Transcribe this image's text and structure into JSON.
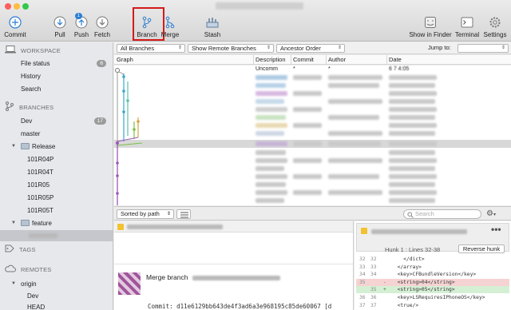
{
  "toolbar": {
    "items": [
      {
        "label": "Commit"
      },
      {
        "label": "Pull"
      },
      {
        "label": "Push",
        "badge": "1"
      },
      {
        "label": "Fetch"
      },
      {
        "label": "Branch"
      },
      {
        "label": "Merge"
      },
      {
        "label": "Stash"
      },
      {
        "label": "Show in Finder"
      },
      {
        "label": "Terminal"
      },
      {
        "label": "Settings"
      }
    ]
  },
  "sidebar": {
    "workspace": "WORKSPACE",
    "file_status": "File status",
    "file_status_count": "6",
    "history": "History",
    "search": "Search",
    "branches": "BRANCHES",
    "dev": "Dev",
    "dev_count": "17",
    "master": "master",
    "release": "Release",
    "release_branches": [
      "101R04P",
      "101R04T",
      "101R05",
      "101R05P",
      "101R05T"
    ],
    "feature": "feature",
    "tags": "TAGS",
    "remotes": "REMOTES",
    "origin": "origin",
    "remote_dev": "Dev",
    "remote_head": "HEAD"
  },
  "filter": {
    "branches": "All Branches",
    "remote": "Show Remote Branches",
    "order": "Ancestor Order",
    "jump_label": "Jump to:"
  },
  "table": {
    "columns": [
      "Graph",
      "Description",
      "Commit",
      "Author",
      "Date"
    ],
    "first_row": {
      "description": "Uncomm",
      "commit": "*",
      "author": "*",
      "date": "6 7 4:05"
    }
  },
  "lower": {
    "sort": "Sorted by path",
    "search_placeholder": "Search"
  },
  "details": {
    "title": "Merge branch",
    "commit_label": "Commit:",
    "commit_hash": "d11e6129bb643de4f3ad6a3e968195c85de60067 [d"
  },
  "diff": {
    "hunk_label": "Hunk 1 : Lines 32-38",
    "reverse_label": "Reverse hunk",
    "lines": [
      {
        "n1": "32",
        "n2": "32",
        "sign": "",
        "code": "    </dict>",
        "kind": "ctx"
      },
      {
        "n1": "33",
        "n2": "33",
        "sign": "",
        "code": "  </array>",
        "kind": "ctx"
      },
      {
        "n1": "34",
        "n2": "34",
        "sign": "",
        "code": "  <key>CFBundleVersion</key>",
        "kind": "ctx"
      },
      {
        "n1": "35",
        "n2": "",
        "sign": "-",
        "code": "  <string>04</string>",
        "kind": "del"
      },
      {
        "n1": "",
        "n2": "35",
        "sign": "+",
        "code": "  <string>05</string>",
        "kind": "add"
      },
      {
        "n1": "36",
        "n2": "36",
        "sign": "",
        "code": "  <key>LSRequiresIPhoneOS</key>",
        "kind": "ctx"
      },
      {
        "n1": "37",
        "n2": "37",
        "sign": "",
        "code": "  <true/>",
        "kind": "ctx"
      }
    ]
  },
  "colors": {
    "highlight": "#d41a1a",
    "accent": "#2a7fd4",
    "diff_del": "#f6d3d3",
    "diff_add": "#d5efd5"
  }
}
